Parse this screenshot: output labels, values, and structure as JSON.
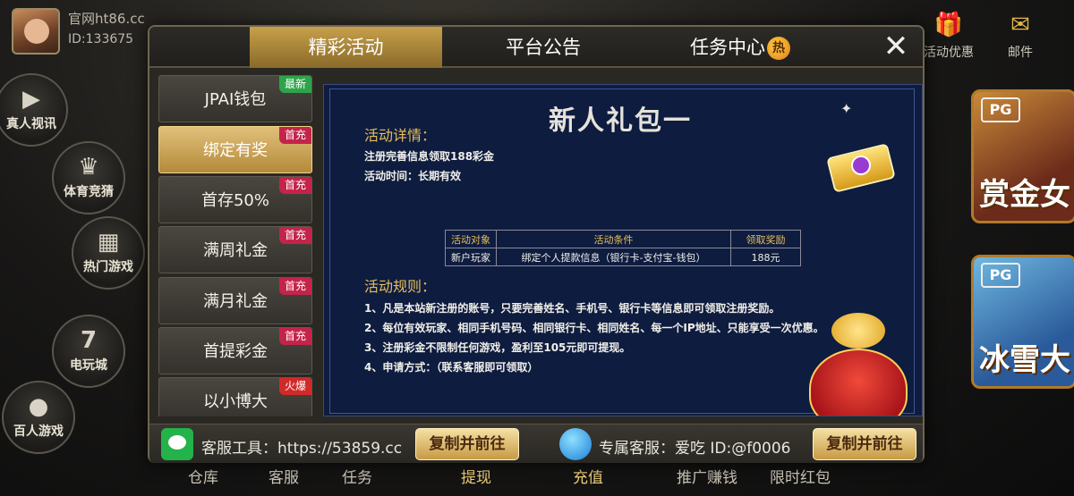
{
  "user": {
    "site": "官网ht86.cc",
    "id": "ID:133675"
  },
  "side_menu": [
    {
      "label": "真人视讯",
      "icon": "video-camera-icon"
    },
    {
      "label": "体育竞猜",
      "icon": "trophy-icon"
    },
    {
      "label": "热门游戏",
      "icon": "grid-icon"
    },
    {
      "label": "电玩城",
      "icon": "slot-777-icon"
    },
    {
      "label": "百人游戏",
      "icon": "poker-chip-icon"
    }
  ],
  "top_icons": [
    {
      "label": "活动优惠",
      "icon": "gift-icon"
    },
    {
      "label": "邮件",
      "icon": "mail-icon"
    }
  ],
  "game_cards": [
    {
      "brand": "PG",
      "name": "赏金女"
    },
    {
      "brand": "PG",
      "name": "冰雪大"
    }
  ],
  "bottom_nav": [
    "仓库",
    "客服",
    "任务",
    "提现",
    "充值",
    "推广赚钱",
    "限时红包"
  ],
  "modal": {
    "tabs": [
      {
        "label": "精彩活动",
        "active": true
      },
      {
        "label": "平台公告",
        "active": false
      },
      {
        "label": "任务中心",
        "active": false,
        "badge": "热"
      }
    ],
    "close_symbol": "✕",
    "menu": [
      {
        "label": "JPAI钱包",
        "tag": "最新",
        "tag_type": "new",
        "active": false
      },
      {
        "label": "绑定有奖",
        "tag": "首充",
        "tag_type": "first",
        "active": true
      },
      {
        "label": "首存50%",
        "tag": "首充",
        "tag_type": "first",
        "active": false
      },
      {
        "label": "满周礼金",
        "tag": "首充",
        "tag_type": "first",
        "active": false
      },
      {
        "label": "满月礼金",
        "tag": "首充",
        "tag_type": "first",
        "active": false
      },
      {
        "label": "首提彩金",
        "tag": "首充",
        "tag_type": "first",
        "active": false
      },
      {
        "label": "以小博大",
        "tag": "火爆",
        "tag_type": "fire",
        "active": false
      }
    ],
    "promo": {
      "title": "新人礼包一",
      "details_heading": "活动详情：",
      "detail_lines": [
        "注册完善信息领取188彩金",
        "活动时间：长期有效"
      ],
      "table": {
        "headers": [
          "活动对象",
          "活动条件",
          "领取奖励"
        ],
        "row": [
          "新户玩家",
          "绑定个人提款信息（银行卡-支付宝-钱包）",
          "188元"
        ]
      },
      "rules_heading": "活动规则：",
      "rules": [
        "1、凡是本站新注册的账号，只要完善姓名、手机号、银行卡等信息即可领取注册奖励。",
        "2、每位有效玩家、相同手机号码、相同银行卡、相同姓名、每一个IP地址、只能享受一次优惠。",
        "3、注册彩金不限制任何游戏，盈利至105元即可提现。",
        "4、申请方式：（联系客服即可领取）"
      ]
    },
    "footer": {
      "tool_text": "客服工具：https://53859.cc",
      "copy_label_1": "复制并前往",
      "service_text": "专属客服：爱吃 ID:@f0006",
      "copy_label_2": "复制并前往"
    }
  }
}
